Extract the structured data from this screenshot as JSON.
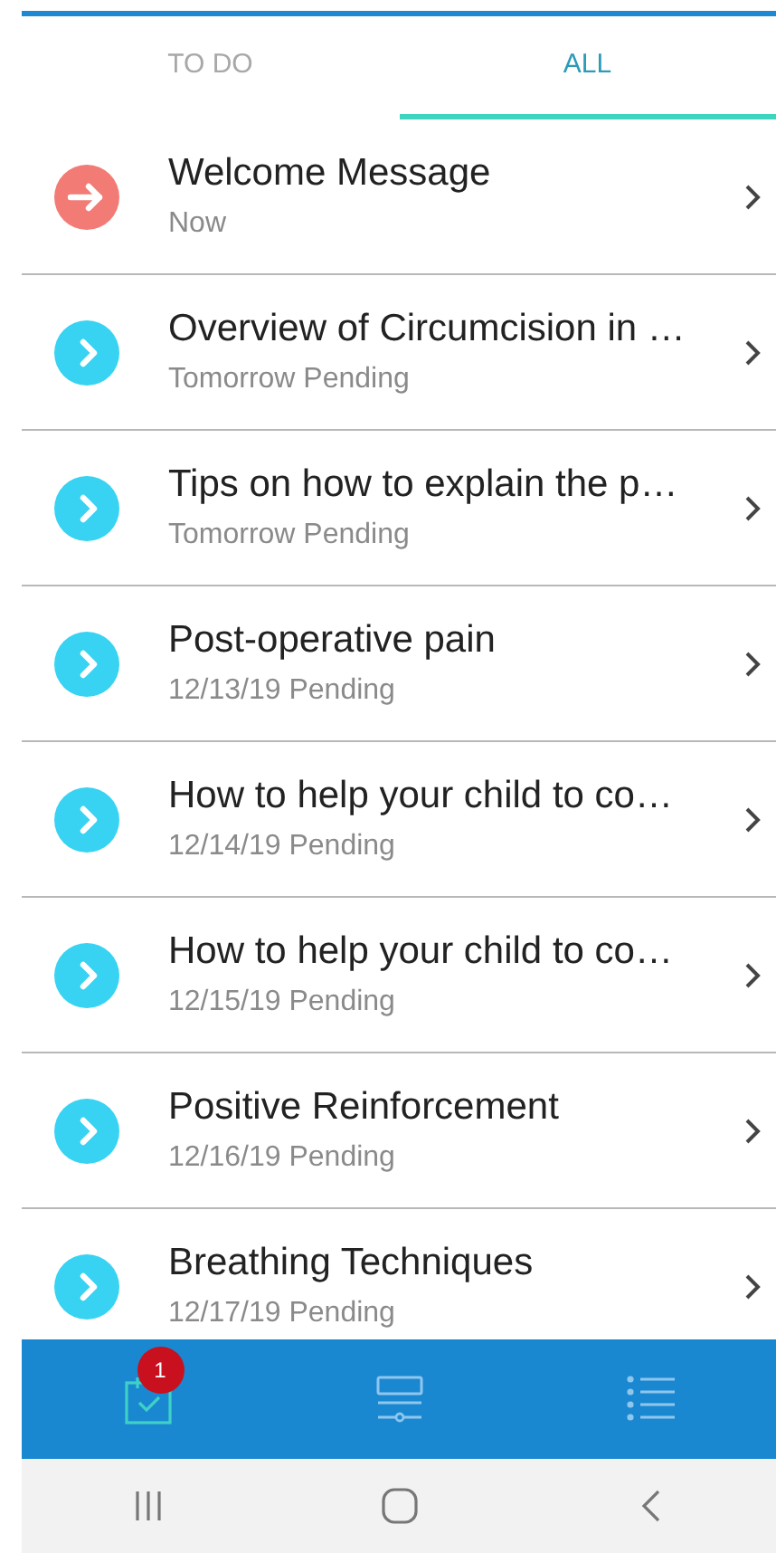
{
  "tabs": [
    {
      "label": "TO DO",
      "selected": false
    },
    {
      "label": "ALL",
      "selected": true
    }
  ],
  "items": [
    {
      "kind": "due",
      "title": "Welcome Message",
      "subtitle": "Now"
    },
    {
      "kind": "pending",
      "title": "Overview of Circumcision in …",
      "subtitle": "Tomorrow Pending"
    },
    {
      "kind": "pending",
      "title": "Tips on how to explain the p…",
      "subtitle": "Tomorrow Pending"
    },
    {
      "kind": "pending",
      "title": "Post-operative pain",
      "subtitle": "12/13/19 Pending"
    },
    {
      "kind": "pending",
      "title": "How to help your child to co…",
      "subtitle": "12/14/19 Pending"
    },
    {
      "kind": "pending",
      "title": "How to help your child to co…",
      "subtitle": "12/15/19 Pending"
    },
    {
      "kind": "pending",
      "title": "Positive Reinforcement",
      "subtitle": "12/16/19 Pending"
    },
    {
      "kind": "pending",
      "title": "Breathing Techniques",
      "subtitle": "12/17/19 Pending"
    }
  ],
  "bottom_nav": [
    {
      "kind": "tasks",
      "selected": true,
      "badge": "1"
    },
    {
      "kind": "timeline",
      "selected": false
    },
    {
      "kind": "list",
      "selected": false
    }
  ]
}
